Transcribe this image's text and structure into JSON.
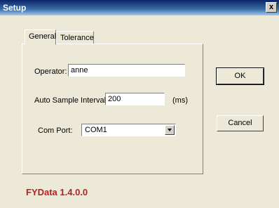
{
  "window": {
    "title": "Setup",
    "close_label": "x"
  },
  "tabs": [
    {
      "label": "General",
      "active": true
    },
    {
      "label": "Tolerance",
      "active": false
    }
  ],
  "form": {
    "operator_label": "Operator:",
    "operator_value": "anne",
    "interval_label": "Auto Sample Interval:",
    "interval_value": "200",
    "interval_unit": "(ms)",
    "comport_label": "Com Port:",
    "comport_value": "COM1"
  },
  "buttons": {
    "ok_label": "OK",
    "cancel_label": "Cancel"
  },
  "footer": {
    "version": "FYData 1.4.0.0",
    "version_color": "#b22222"
  },
  "colors": {
    "dialog_bg": "#ece9d8",
    "titlebar": "#0a246a"
  }
}
